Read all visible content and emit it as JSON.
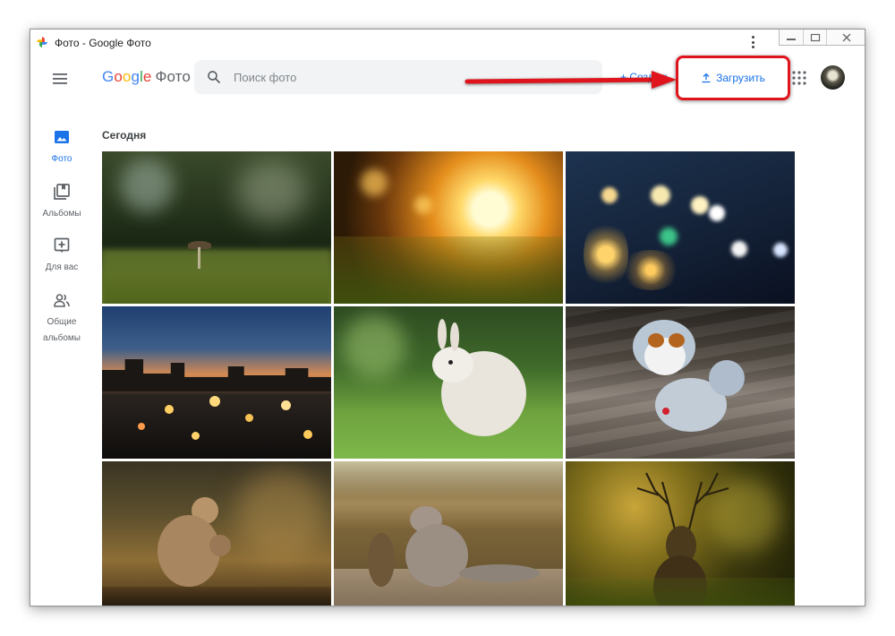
{
  "window": {
    "title": "Фото - Google Фото"
  },
  "header": {
    "logo_google": [
      "G",
      "o",
      "o",
      "g",
      "l",
      "e"
    ],
    "logo_product": "Фото",
    "search_placeholder": "Поиск фото",
    "create_label": "+ Создать",
    "upload_label": "Загрузить"
  },
  "sidebar": {
    "items": [
      {
        "label": "Фото",
        "icon": "photo-icon",
        "active": true
      },
      {
        "label": "Альбомы",
        "icon": "albums-icon",
        "active": false
      },
      {
        "label": "Для вас",
        "icon": "for-you-icon",
        "active": false
      },
      {
        "label": "Общие альбомы",
        "icon": "shared-albums-icon",
        "active": false
      }
    ]
  },
  "main": {
    "section_title": "Сегодня",
    "photos": [
      {
        "subject": "mushroom-forest",
        "palette": [
          "#1d2a17",
          "#6d7c45",
          "#c9d2a8"
        ]
      },
      {
        "subject": "sunset-grass",
        "palette": [
          "#3b2a0a",
          "#d98a18",
          "#fff4b0"
        ]
      },
      {
        "subject": "string-lights",
        "palette": [
          "#0c1424",
          "#28405e",
          "#f5c862"
        ]
      },
      {
        "subject": "city-bokeh-dusk",
        "palette": [
          "#16233a",
          "#e39a4b",
          "#f0b84c"
        ]
      },
      {
        "subject": "white-rabbit",
        "palette": [
          "#253d1e",
          "#7bb24a",
          "#efece6"
        ]
      },
      {
        "subject": "dog-costume",
        "palette": [
          "#3b3630",
          "#8b8378",
          "#b9c8d6"
        ]
      },
      {
        "subject": "monkey",
        "palette": [
          "#2c2416",
          "#a47a3d",
          "#d8b06c"
        ]
      },
      {
        "subject": "cat-and-bird",
        "palette": [
          "#5e4a2e",
          "#c9a874",
          "#8c6a43"
        ]
      },
      {
        "subject": "deer",
        "palette": [
          "#1f1f08",
          "#7c7a1a",
          "#c9a63a"
        ]
      }
    ]
  },
  "colors": {
    "accent": "#1a73e8",
    "highlight": "#e0141c"
  }
}
